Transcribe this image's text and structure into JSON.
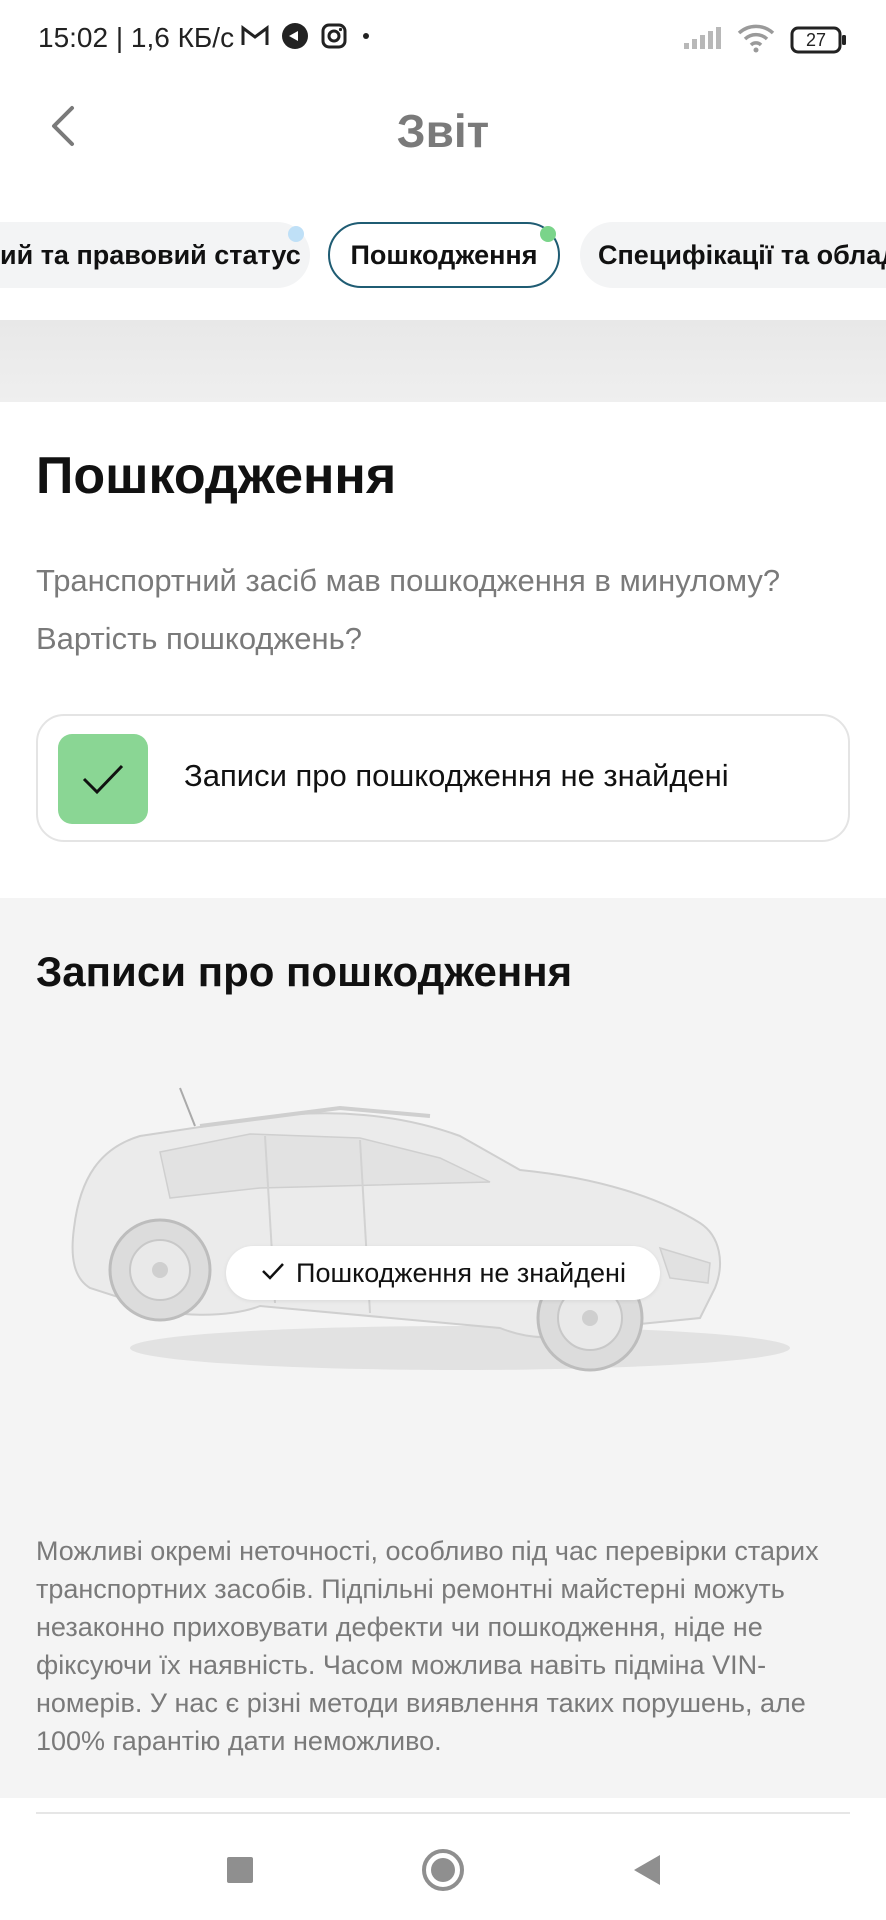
{
  "status_bar": {
    "time": "15:02 | 1,6 КБ/с",
    "battery": "27",
    "icons_left": [
      "gmail-icon",
      "app-notification-icon",
      "instagram-icon",
      "dot-icon"
    ],
    "icons_right": [
      "signal-icon",
      "wifi-icon",
      "battery-icon"
    ]
  },
  "header": {
    "title": "Звіт",
    "back_icon": "chevron-left-icon"
  },
  "tabs": [
    {
      "label": "ий та правовий статус"
    },
    {
      "label": "Пошкодження",
      "active": true
    },
    {
      "label": "Специфікації та облад"
    }
  ],
  "damage": {
    "title": "Пошкодження",
    "description": "Транспортний засіб мав пошкодження в минулому? Вартість пошкоджень?",
    "result_text": "Записи про пошкодження не знайдені"
  },
  "records": {
    "title": "Записи про пошкодження",
    "badge": "Пошкодження не знайдені",
    "disclaimer": "Можливі окремі неточності, особливо під час перевірки старих транспортних засобів. Підпільні ремонтні майстерні можуть незаконно приховувати дефекти чи пошкодження, ніде не фіксуючи їх наявність. Часом можлива навіть підміна VIN-номерів. У нас є різні методи виявлення таких порушень, але 100% гарантію дати неможливо."
  },
  "colors": {
    "accent_border": "#1f5c73",
    "success_green": "#8ad694",
    "notify_green": "#7ad48a",
    "notify_blue": "#bfe0f7",
    "muted_text": "#7a7a7a"
  },
  "nav_bar": [
    "recents-icon",
    "home-icon",
    "back-triangle-icon"
  ]
}
